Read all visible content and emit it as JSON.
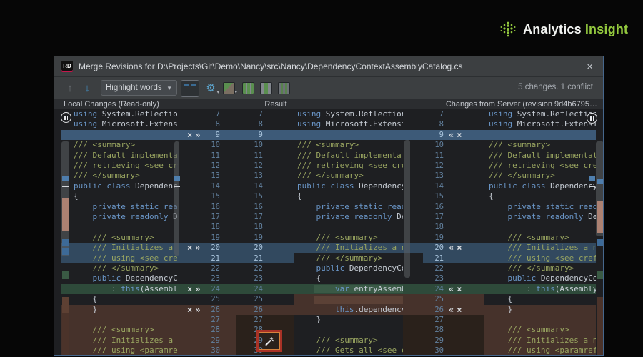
{
  "page": {
    "logo": {
      "word1": "Analytics",
      "word2": "Insight",
      "accent_color": "#93c83e"
    }
  },
  "window": {
    "app_icon_label": "RD",
    "title": "Merge Revisions for D:\\Projects\\Git\\Demo\\Nancy\\src\\Nancy\\DependencyContextAssemblyCatalog.cs",
    "close_glyph": "×"
  },
  "toolbar": {
    "up_glyph": "↑",
    "down_glyph": "↓",
    "highlight_dropdown_value": "Highlight words",
    "dropdown_caret": "▼",
    "gear_glyph": "⚙",
    "status": "5 changes. 1 conflict"
  },
  "pane_headers": {
    "left": "Local Changes (Read-only)",
    "center": "Result",
    "right": "Changes from Server (revision 9d4b6795…"
  },
  "gutter": {
    "left_icons": [
      "×",
      "»"
    ],
    "right_icons": [
      "«",
      "×"
    ],
    "wand_tooltip": "Resolve simple conflicts"
  },
  "colors": {
    "changed_blue": "#32495f",
    "changed_blue_bright": "#3d5a78",
    "inserted_green": "#2e4a3a",
    "conflict_brown": "#46322b",
    "keyword": "#6a96c8",
    "comment": "#9aa661",
    "plain": "#c5cbd3"
  },
  "syntax_keywords": [
    "using",
    "public",
    "class",
    "private",
    "static",
    "readonly",
    "var",
    "this"
  ],
  "panes": {
    "left": {
      "lines": [
        {
          "n": 7,
          "t": "using System.Reflection;"
        },
        {
          "n": 8,
          "t": "using Microsoft.Extensions.DependencyModel;"
        },
        {
          "n": 9,
          "t": "",
          "hl": "B",
          "ic": 1
        },
        {
          "n": 10,
          "t": "/// <summary>"
        },
        {
          "n": 11,
          "t": "/// Default implementation of the <see cref"
        },
        {
          "n": 12,
          "t": "/// retrieving <see cref=\"Assembly\"/> infor"
        },
        {
          "n": 13,
          "t": "/// </summary>"
        },
        {
          "n": 14,
          "t": "public class DependencyContextAssemblyCata"
        },
        {
          "n": 15,
          "t": "{"
        },
        {
          "n": 16,
          "t": "    private static readonly string[] Exclu"
        },
        {
          "n": 17,
          "t": "    private readonly DependencyContext dep"
        },
        {
          "n": 18,
          "t": ""
        },
        {
          "n": 19,
          "t": "    /// <summary>"
        },
        {
          "n": 20,
          "t": "    /// Initializes a new instance of the ",
          "hl": "b",
          "ic": 1
        },
        {
          "n": 21,
          "t": "    /// using <see cref=\"DependencyContext",
          "hl": "b"
        },
        {
          "n": 22,
          "t": "    /// </summary>"
        },
        {
          "n": 23,
          "t": "    public DependencyContextAssemblyCatalo"
        },
        {
          "n": 24,
          "t": "        : this(AssemblyCatalog.Default)",
          "hl": "g",
          "ic": 1
        },
        {
          "n": 25,
          "t": "    {"
        },
        {
          "n": 26,
          "t": "    }",
          "hl": "c",
          "ic": 1
        },
        {
          "n": 27,
          "t": "",
          "hl": "c"
        },
        {
          "n": 28,
          "t": "    /// <summary>",
          "hl": "c"
        },
        {
          "n": 29,
          "t": "    /// Initializes a new instance of the ",
          "hl": "c"
        },
        {
          "n": 30,
          "t": "    /// using <paramref name=\"dependencyCo",
          "hl": "c"
        }
      ]
    },
    "result": {
      "lines": [
        {
          "n": 7,
          "t": "using System.Reflection;"
        },
        {
          "n": 8,
          "t": "using Microsoft.Extensions.DependencyMod"
        },
        {
          "n": 9,
          "t": "",
          "hl": "B",
          "ic": 1
        },
        {
          "n": 10,
          "t": "/// <summary>"
        },
        {
          "n": 11,
          "t": "/// Default implementation of the <see c"
        },
        {
          "n": 12,
          "t": "/// retrieving <see cref=\"Assembly\"/> in"
        },
        {
          "n": 13,
          "t": "/// </summary>"
        },
        {
          "n": 14,
          "t": "public class DependencyContextAssemblyCa"
        },
        {
          "n": 15,
          "t": "{"
        },
        {
          "n": 16,
          "t": "    private static readonly string[] Exc"
        },
        {
          "n": 17,
          "t": "    private readonly DependencyContext d"
        },
        {
          "n": 18,
          "t": ""
        },
        {
          "n": 19,
          "t": "    /// <summary>"
        },
        {
          "n": 20,
          "t": "    /// Initializes a new instance of th",
          "hl": "b",
          "ic": 1
        },
        {
          "n": 21,
          "t": "    /// </summary>",
          "hl": "b"
        },
        {
          "n": 22,
          "t": "    public DependencyContextAssemblyCat"
        },
        {
          "n": 23,
          "t": "    {"
        },
        {
          "n": 24,
          "t": "        var entryAssembly = Assembly.Ge",
          "hl": "g",
          "ic": 1
        },
        {
          "n": 25,
          "t": "",
          "hl": "c"
        },
        {
          "n": 26,
          "t": "        this.dependencyContext = Depend",
          "hl": "c",
          "ic": 1
        },
        {
          "n": 27,
          "t": "    }"
        },
        {
          "n": 28,
          "t": ""
        },
        {
          "n": 29,
          "t": "    /// <summary>"
        },
        {
          "n": 30,
          "t": "    /// Gets all <see cref=\"AssemblyCat"
        }
      ]
    },
    "right": {
      "lines": [
        {
          "n": 7,
          "t": "using System.Reflection;"
        },
        {
          "n": 8,
          "t": "using Microsoft.Extensions.DependencyMo"
        },
        {
          "n": 9,
          "t": "",
          "hl": "B",
          "ic": 1
        },
        {
          "n": 10,
          "t": "/// <summary>"
        },
        {
          "n": 11,
          "t": "/// Default implementation of the <see"
        },
        {
          "n": 12,
          "t": "/// retrieving <see cref=\"Assembly\"/> i"
        },
        {
          "n": 13,
          "t": "/// </summary>"
        },
        {
          "n": 14,
          "t": "public class DependencyContextAssembly"
        },
        {
          "n": 15,
          "t": "{"
        },
        {
          "n": 16,
          "t": "    private static readonly string[] E"
        },
        {
          "n": 17,
          "t": "    private readonly DependencyContext"
        },
        {
          "n": 18,
          "t": ""
        },
        {
          "n": 19,
          "t": "    /// <summary>"
        },
        {
          "n": 20,
          "t": "    /// Initializes a new instance of ",
          "hl": "b",
          "ic": 1
        },
        {
          "n": 21,
          "t": "    /// using <see cref=\"DependencyCon",
          "hl": "b"
        },
        {
          "n": 22,
          "t": "    /// </summary>"
        },
        {
          "n": 23,
          "t": "    public DependencyContextAssemblyCa"
        },
        {
          "n": 24,
          "t": "        : this(AssemblyCatalog.Defaul",
          "hl": "g",
          "ic": 1
        },
        {
          "n": 25,
          "t": "    {"
        },
        {
          "n": 26,
          "t": "    }",
          "hl": "c",
          "ic": 1
        },
        {
          "n": 27,
          "t": "",
          "hl": "c"
        },
        {
          "n": 28,
          "t": "    /// <summary>",
          "hl": "c"
        },
        {
          "n": 29,
          "t": "    /// Initializes a new instance of ",
          "hl": "c"
        },
        {
          "n": 30,
          "t": "    /// using <paramref name=\"dependen",
          "hl": "c"
        }
      ]
    }
  }
}
